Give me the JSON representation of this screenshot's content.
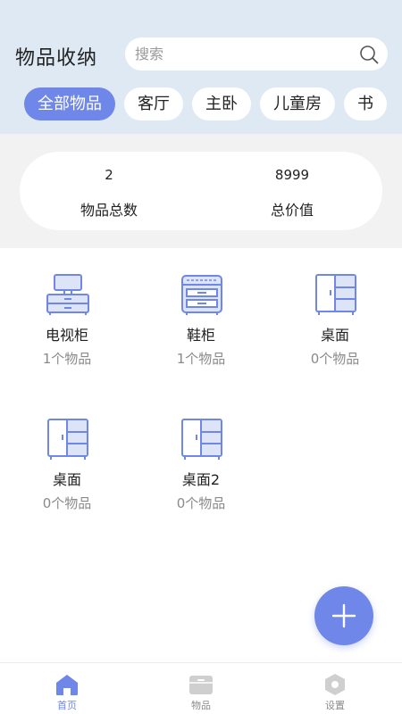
{
  "header": {
    "title": "物品收纳",
    "search": {
      "placeholder": "搜索",
      "value": "",
      "icon": "search-icon"
    }
  },
  "tabs": [
    {
      "label": "全部物品",
      "active": true
    },
    {
      "label": "客厅"
    },
    {
      "label": "主卧"
    },
    {
      "label": "儿童房"
    },
    {
      "label": "书"
    }
  ],
  "stats": {
    "total_items": {
      "value": "2",
      "label": "物品总数"
    },
    "total_value": {
      "value": "8999",
      "label": "总价值"
    }
  },
  "containers": [
    {
      "name": "电视柜",
      "count": "1个物品",
      "icon": "tv-cabinet-icon"
    },
    {
      "name": "鞋柜",
      "count": "1个物品",
      "icon": "shoe-cabinet-icon"
    },
    {
      "name": "桌面",
      "count": "0个物品",
      "icon": "wardrobe-icon"
    },
    {
      "name": "桌面",
      "count": "0个物品",
      "icon": "wardrobe-icon"
    },
    {
      "name": "桌面2",
      "count": "0个物品",
      "icon": "wardrobe-icon"
    }
  ],
  "fab": {
    "icon": "plus-icon"
  },
  "bottom_nav": [
    {
      "label": "首页",
      "icon": "home-icon",
      "active": true
    },
    {
      "label": "物品",
      "icon": "box-icon"
    },
    {
      "label": "设置",
      "icon": "settings-icon"
    }
  ],
  "colors": {
    "accent": "#6f87e8",
    "header_bg": "#dfe9f3",
    "icon_fill": "#dde4f7",
    "nav_inactive": "#cfcfcf"
  }
}
